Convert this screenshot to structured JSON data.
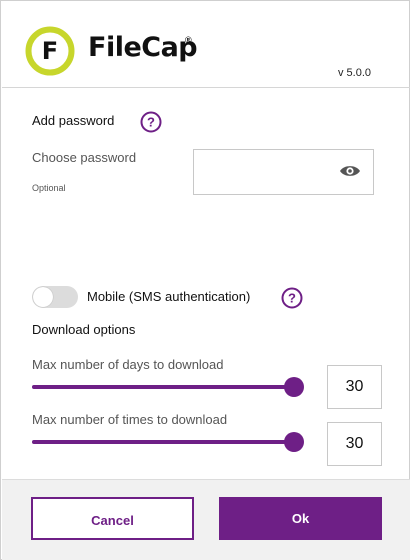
{
  "header": {
    "logo_letter": "F",
    "app_name": "FileCap",
    "registered_mark": "®",
    "version": "v 5.0.0"
  },
  "password": {
    "heading": "Add password",
    "field_label": "Choose password",
    "field_hint": "Optional",
    "value": "",
    "icon": "eye-icon"
  },
  "sms": {
    "label": "Mobile (SMS authentication)",
    "enabled": false
  },
  "download": {
    "heading": "Download options",
    "days_label": "Max number of days to download",
    "days_value": "30",
    "days_slider_fraction": 1.0,
    "times_label": "Max number of times to download",
    "times_value": "30",
    "times_slider_fraction": 1.0
  },
  "help_icon_glyph": "?",
  "buttons": {
    "cancel_label": "Cancel",
    "ok_label": "Ok"
  },
  "colors": {
    "accent": "#6e1f86",
    "logo_ring": "#c7d62c",
    "footer_bg": "#f1f1f1"
  }
}
